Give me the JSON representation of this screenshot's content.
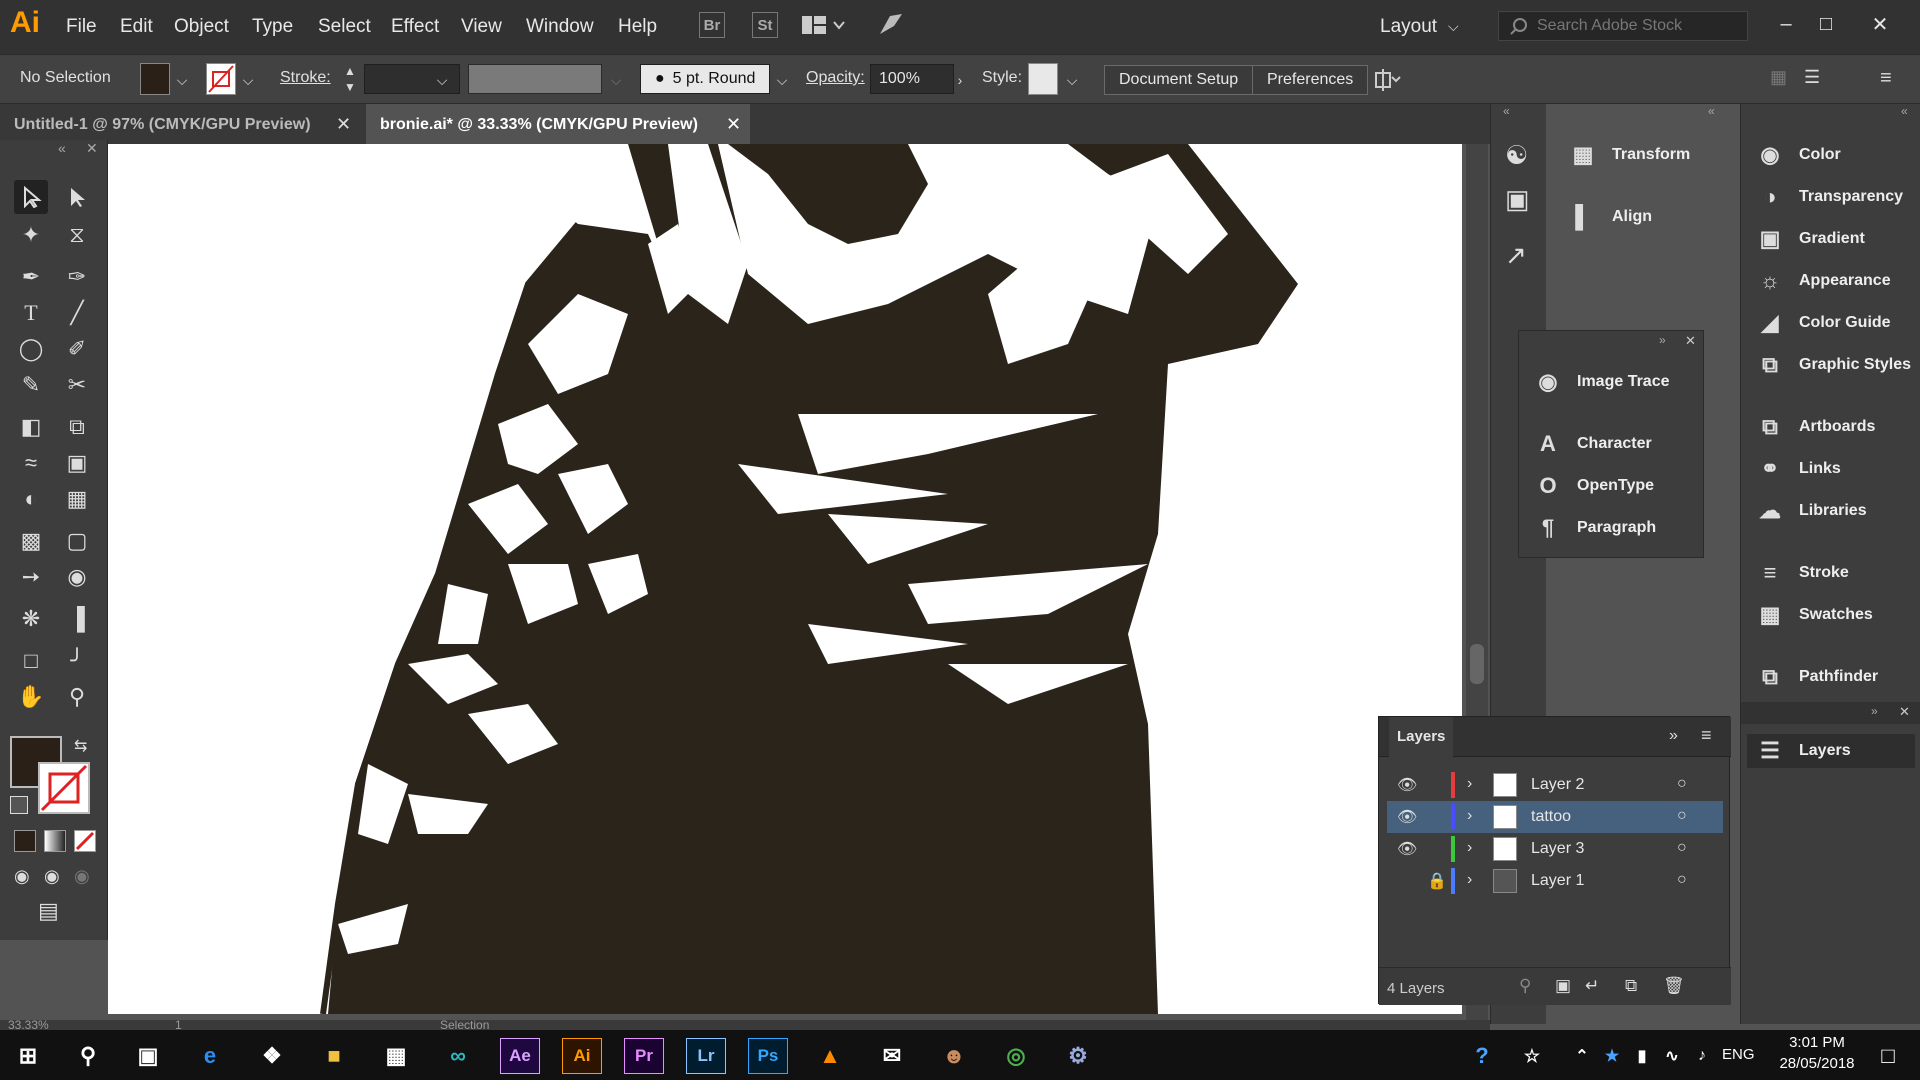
{
  "app": {
    "logo": "Ai"
  },
  "menu": [
    "File",
    "Edit",
    "Object",
    "Type",
    "Select",
    "Effect",
    "View",
    "Window",
    "Help"
  ],
  "menu_extras": {
    "bridge": "Br",
    "stock": "St"
  },
  "workspace": {
    "label": "Layout"
  },
  "search": {
    "placeholder": "Search Adobe Stock"
  },
  "control_bar": {
    "selection": "No Selection",
    "stroke_label": "Stroke:",
    "brush": "5 pt. Round",
    "opacity_label": "Opacity:",
    "opacity_value": "100%",
    "style_label": "Style:",
    "document_setup": "Document Setup",
    "preferences": "Preferences"
  },
  "tabs": [
    {
      "title": "Untitled-1 @ 97% (CMYK/GPU Preview)"
    },
    {
      "title": "bronie.ai* @ 33.33% (CMYK/GPU Preview)"
    }
  ],
  "dock_mid": [
    {
      "icon": "transform-icon",
      "label": "Transform"
    },
    {
      "icon": "align-icon",
      "label": "Align"
    }
  ],
  "float_panel": [
    {
      "icon": "image-trace-icon",
      "label": "Image Trace"
    },
    {
      "icon": "character-icon",
      "label": "Character"
    },
    {
      "icon": "opentype-icon",
      "label": "OpenType"
    },
    {
      "icon": "paragraph-icon",
      "label": "Paragraph"
    }
  ],
  "dock_right": [
    {
      "icon": "color-icon",
      "label": "Color"
    },
    {
      "icon": "transparency-icon",
      "label": "Transparency"
    },
    {
      "icon": "gradient-icon",
      "label": "Gradient"
    },
    {
      "icon": "appearance-icon",
      "label": "Appearance"
    },
    {
      "icon": "color-guide-icon",
      "label": "Color Guide"
    },
    {
      "icon": "graphic-styles-icon",
      "label": "Graphic Styles"
    },
    {
      "icon": "artboards-icon",
      "label": "Artboards"
    },
    {
      "icon": "links-icon",
      "label": "Links"
    },
    {
      "icon": "libraries-icon",
      "label": "Libraries"
    },
    {
      "icon": "stroke-icon",
      "label": "Stroke"
    },
    {
      "icon": "swatches-icon",
      "label": "Swatches"
    },
    {
      "icon": "pathfinder-icon",
      "label": "Pathfinder"
    }
  ],
  "layers_dock": {
    "label": "Layers"
  },
  "layers_panel": {
    "title": "Layers",
    "count": "4 Layers",
    "layers": [
      {
        "name": "Layer 2",
        "color": "#e63c3c",
        "visible": true,
        "locked": false,
        "selected": false
      },
      {
        "name": "tattoo",
        "color": "#4b4bff",
        "visible": true,
        "locked": false,
        "selected": true
      },
      {
        "name": "Layer 3",
        "color": "#3cc83c",
        "visible": true,
        "locked": false,
        "selected": false
      },
      {
        "name": "Layer 1",
        "color": "#4b7cff",
        "visible": false,
        "locked": true,
        "selected": false
      }
    ]
  },
  "status": {
    "zoom": "33.33%",
    "page": "1",
    "mode": "Selection"
  },
  "taskbar": {
    "language": "ENG",
    "time": "3:01 PM",
    "date": "28/05/2018",
    "apps": [
      "Ae",
      "Ai",
      "Pr",
      "Lr",
      "Ps"
    ]
  },
  "colors": {
    "fill": "#2a2018",
    "accent": "#ff9a00",
    "artwork": "#2b241a"
  }
}
